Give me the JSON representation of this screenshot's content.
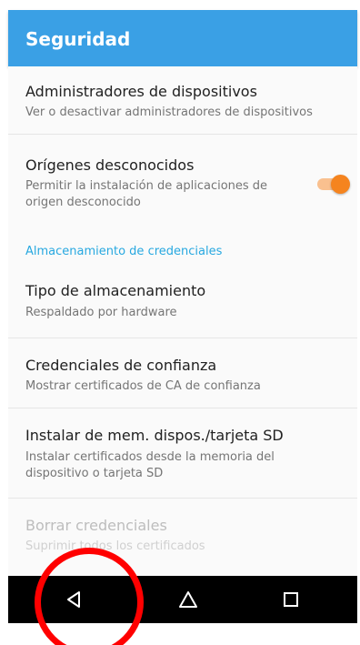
{
  "appbar": {
    "title": "Seguridad"
  },
  "prefs": {
    "device_admins": {
      "title": "Administradores de dispositivos",
      "subtitle": "Ver o desactivar administradores de dispositivos"
    },
    "unknown_sources": {
      "title": "Orígenes desconocidos",
      "subtitle": "Permitir la instalación de aplicaciones de origen desconocido",
      "toggle_on": true
    },
    "storage_type": {
      "title": "Tipo de almacenamiento",
      "subtitle": "Respaldado por hardware"
    },
    "trusted_creds": {
      "title": "Credenciales de confianza",
      "subtitle": "Mostrar certificados de CA de confianza"
    },
    "install_sd": {
      "title": "Instalar de mem. dispos./tarjeta SD",
      "subtitle": "Instalar certificados desde la memoria del dispositivo o tarjeta SD"
    },
    "clear_creds": {
      "title": "Borrar credenciales",
      "subtitle": "Suprimir todos los certificados",
      "enabled": false
    }
  },
  "sections": {
    "credential_storage": "Almacenamiento de credenciales"
  },
  "colors": {
    "accent": "#3aa0e5",
    "toggle": "#f5841f",
    "section_header": "#27a8e0",
    "annotation": "#ff0000"
  },
  "navbar": {
    "buttons": [
      "back-icon",
      "home-icon",
      "recents-icon"
    ]
  }
}
